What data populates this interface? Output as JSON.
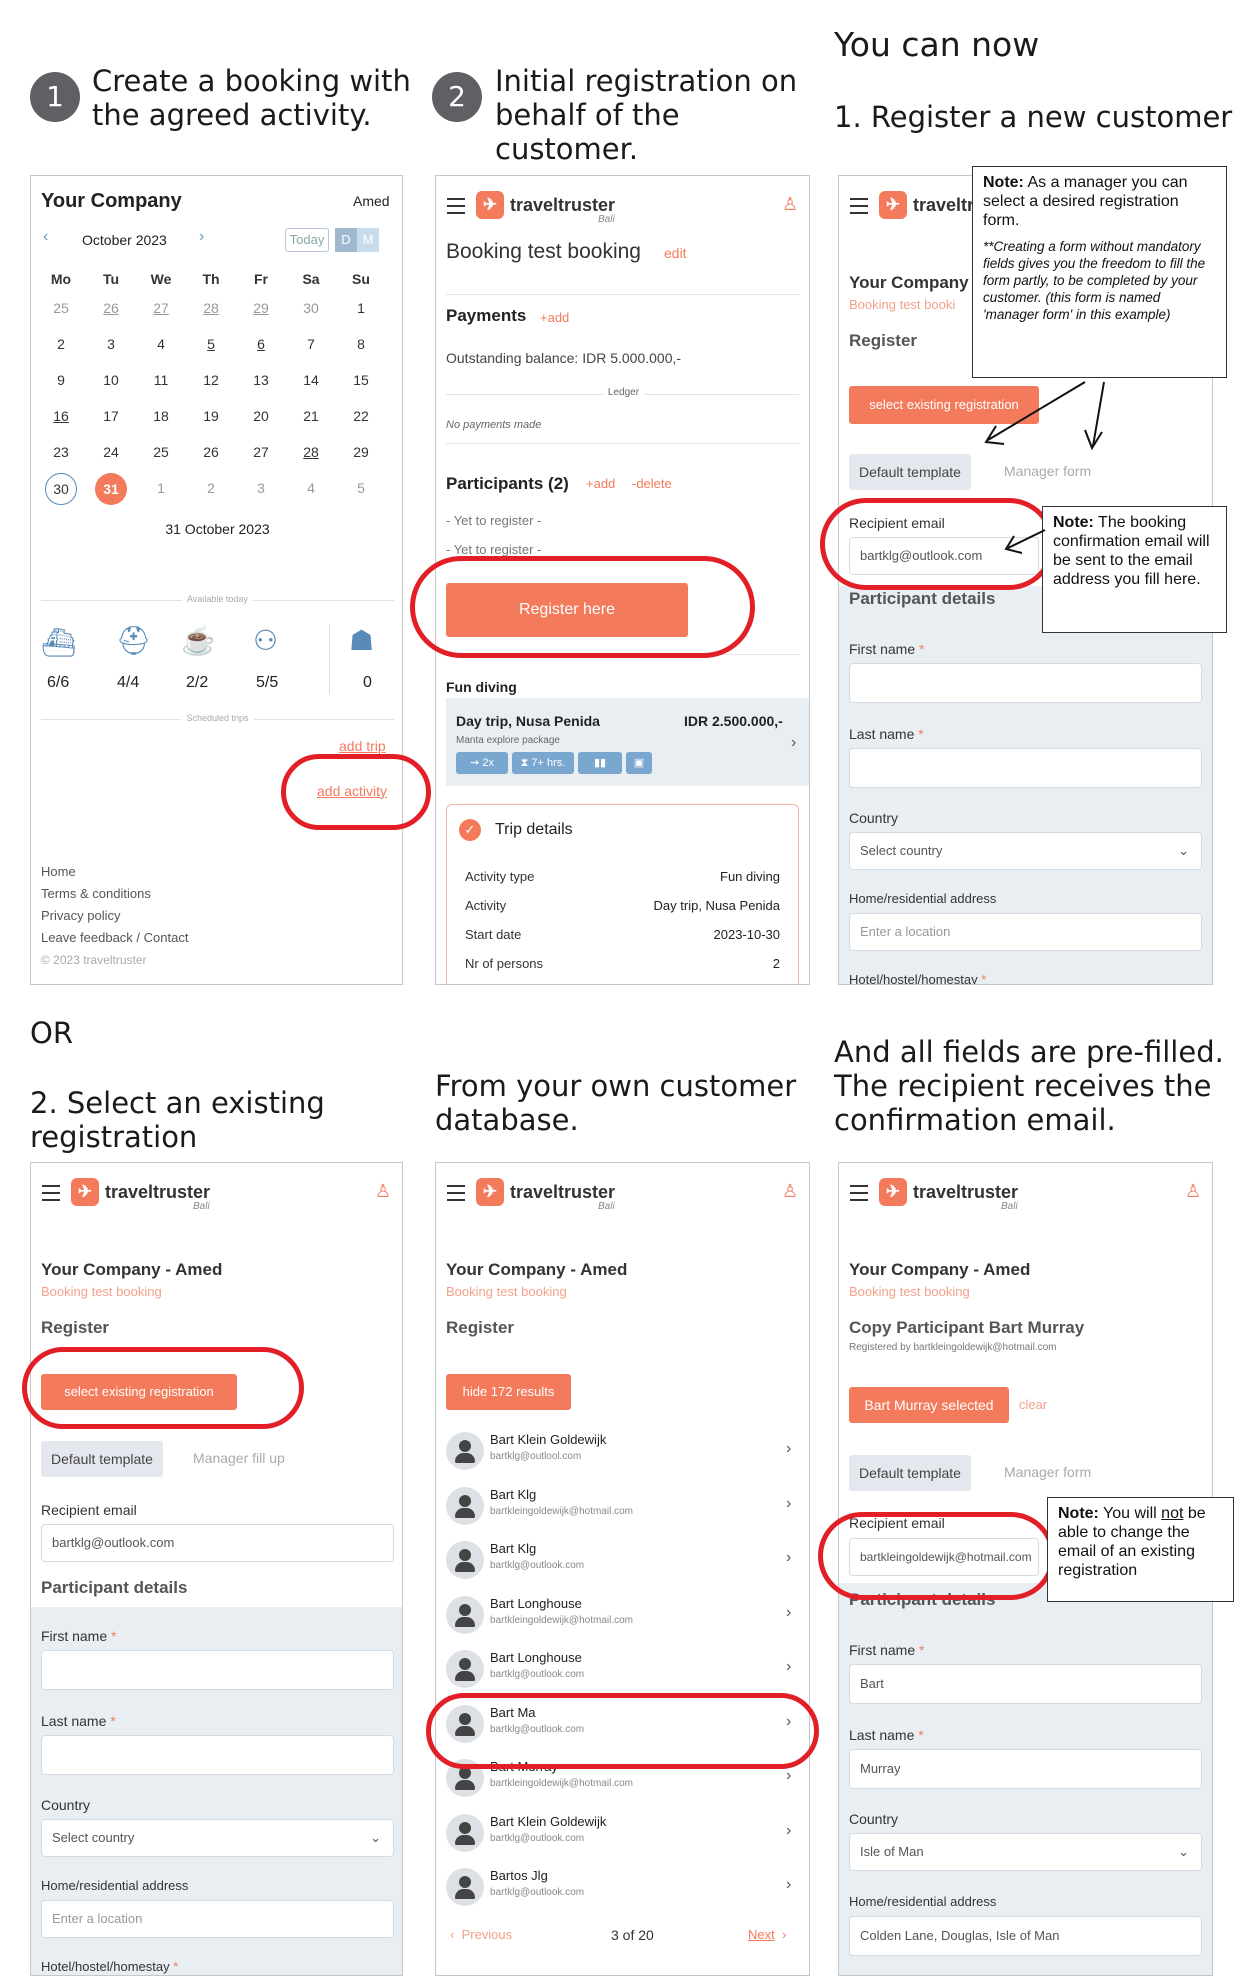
{
  "headings": {
    "step1": "Create a booking with the agreed activity.",
    "step1_num": "1",
    "step2": "Initial registration on behalf of the customer.",
    "step2_num": "2",
    "you_can_now": "You can now",
    "register_new": "1. Register a new customer",
    "or": "OR",
    "select_existing": "2. Select an existing registration",
    "own_db": "From your own customer database.",
    "prefilled": "And all fields are pre-filled. The recipient receives the confirmation email."
  },
  "cal_panel": {
    "company": "Your Company",
    "location": "Amed",
    "month": "October 2023",
    "today": "Today",
    "d": "D",
    "m": "M",
    "weekdays": [
      "Mo",
      "Tu",
      "We",
      "Th",
      "Fr",
      "Sa",
      "Su"
    ],
    "weeks": [
      [
        "25",
        "26",
        "27",
        "28",
        "29",
        "30",
        "1"
      ],
      [
        "2",
        "3",
        "4",
        "5",
        "6",
        "7",
        "8"
      ],
      [
        "9",
        "10",
        "11",
        "12",
        "13",
        "14",
        "15"
      ],
      [
        "16",
        "17",
        "18",
        "19",
        "20",
        "21",
        "22"
      ],
      [
        "23",
        "24",
        "25",
        "26",
        "27",
        "28",
        "29"
      ],
      [
        "30",
        "31",
        "1",
        "2",
        "3",
        "4",
        "5"
      ]
    ],
    "selected_date": "31 October 2023",
    "available_today": "Available today",
    "stats": [
      "6/6",
      "4/4",
      "2/2",
      "5/5",
      "0"
    ],
    "scheduled_trips": "Scheduled trips",
    "add_trip": "add trip",
    "add_activity": "add activity",
    "footer": [
      "Home",
      "Terms & conditions",
      "Privacy policy",
      "Leave feedback / Contact"
    ],
    "copyright": "© 2023 traveltruster"
  },
  "brand": {
    "name": "traveltruster",
    "sub": "Bali",
    "logo_glyph": "✈"
  },
  "booking_panel": {
    "title": "Booking test booking",
    "edit": "edit",
    "payments": "Payments",
    "add": "+add",
    "outstanding": "Outstanding balance: IDR 5.000.000,-",
    "ledger": "Ledger",
    "no_payments": "No payments made",
    "participants": "Participants (2)",
    "p_add": "+add",
    "p_delete": "-delete",
    "yet1": "- Yet to register -",
    "yet2": "- Yet to register -",
    "register_here": "Register here",
    "fun_diving": "Fun diving",
    "trip_name": "Day trip, Nusa Penida",
    "trip_price": "IDR 2.500.000,-",
    "trip_package": "Manta explore package",
    "chips": [
      "2x",
      "7+ hrs.",
      "",
      ""
    ],
    "trip_details": "Trip details",
    "details": [
      [
        "Activity type",
        "Fun diving"
      ],
      [
        "Activity",
        "Day trip, Nusa Penida"
      ],
      [
        "Start date",
        "2023-10-30"
      ],
      [
        "Nr of persons",
        "2"
      ]
    ]
  },
  "register_panel": {
    "company": "Your Company",
    "booking": "Booking test booki",
    "register": "Register",
    "select_existing": "select existing registration",
    "default_template": "Default template",
    "manager_form": "Manager form",
    "recipient_email": "Recipient email",
    "email_value": "bartklg@outlook.com",
    "participant_details": "Participant details",
    "first_name": "First name",
    "last_name": "Last name",
    "country": "Country",
    "select_country": "Select country",
    "address": "Home/residential address",
    "address_ph": "Enter a location",
    "hotel": "Hotel/hostel/homestay",
    "note1_bold": "Note:",
    "note1": "As a manager you can select a desired registration form.",
    "note1_italic": "**Creating a form without mandatory fields gives you the freedom to fill the form partly, to be completed by your customer. (this form is named 'manager form' in this example)",
    "note2_bold": "Note:",
    "note2": "The booking confirmation email will be sent to the email address you fill here."
  },
  "select_panel": {
    "company": "Your Company - Amed",
    "booking": "Booking test booking",
    "register": "Register",
    "select_existing": "select existing registration",
    "default_template": "Default template",
    "manager_fill": "Manager fill up",
    "recipient_email": "Recipient email",
    "email_value": "bartklg@outlook.com",
    "participant_details": "Participant details",
    "first_name": "First name",
    "last_name": "Last name",
    "country": "Country",
    "select_country": "Select country",
    "address": "Home/residential address",
    "address_ph": "Enter a location",
    "hotel": "Hotel/hostel/homestay"
  },
  "list_panel": {
    "company": "Your Company - Amed",
    "booking": "Booking test booking",
    "register": "Register",
    "hide_results": "hide 172 results",
    "results": [
      {
        "name": "Bart Klein Goldewijk",
        "email": "bartklg@outlool.com"
      },
      {
        "name": "Bart Klg",
        "email": "bartkleingoldewijk@hotmail.com"
      },
      {
        "name": "Bart Klg",
        "email": "bartklg@outlook.com"
      },
      {
        "name": "Bart Longhouse",
        "email": "bartkleingoldewijk@hotmail.com"
      },
      {
        "name": "Bart Longhouse",
        "email": "bartklg@outlook.com"
      },
      {
        "name": "Bart Ma",
        "email": "bartklg@outlook.com"
      },
      {
        "name": "Bart Murray",
        "email": "bartkleingoldewijk@hotmail.com"
      },
      {
        "name": "Bart Klein Goldewijk",
        "email": "bartklg@outlook.com"
      },
      {
        "name": "Bartos Jlg",
        "email": "bartklg@outlook.com"
      }
    ],
    "previous": "Previous",
    "page": "3 of 20",
    "next": "Next"
  },
  "copy_panel": {
    "company": "Your Company - Amed",
    "booking": "Booking test booking",
    "title": "Copy Participant Bart Murray",
    "registered_by": "Registered by bartkleingoldewijk@hotmail.com",
    "selected": "Bart Murray selected",
    "clear": "clear",
    "default_template": "Default template",
    "manager_form": "Manager form",
    "recipient_email": "Recipient email",
    "email_value": "bartkleingoldewijk@hotmail.com",
    "participant_details": "Participant details",
    "first_name": "First name",
    "first_value": "Bart",
    "last_name": "Last name",
    "last_value": "Murray",
    "country": "Country",
    "country_value": "Isle of Man",
    "address": "Home/residential address",
    "address_value": "Colden Lane, Douglas, Isle of Man",
    "note_bold": "Note:",
    "note_pre": "You will",
    "note_not": "not",
    "note_post": "be able to change the email of an existing registration"
  },
  "colors": {
    "accent": "#f47a5c",
    "highlight": "#e21f26",
    "panel_bg": "#e9eef3"
  }
}
